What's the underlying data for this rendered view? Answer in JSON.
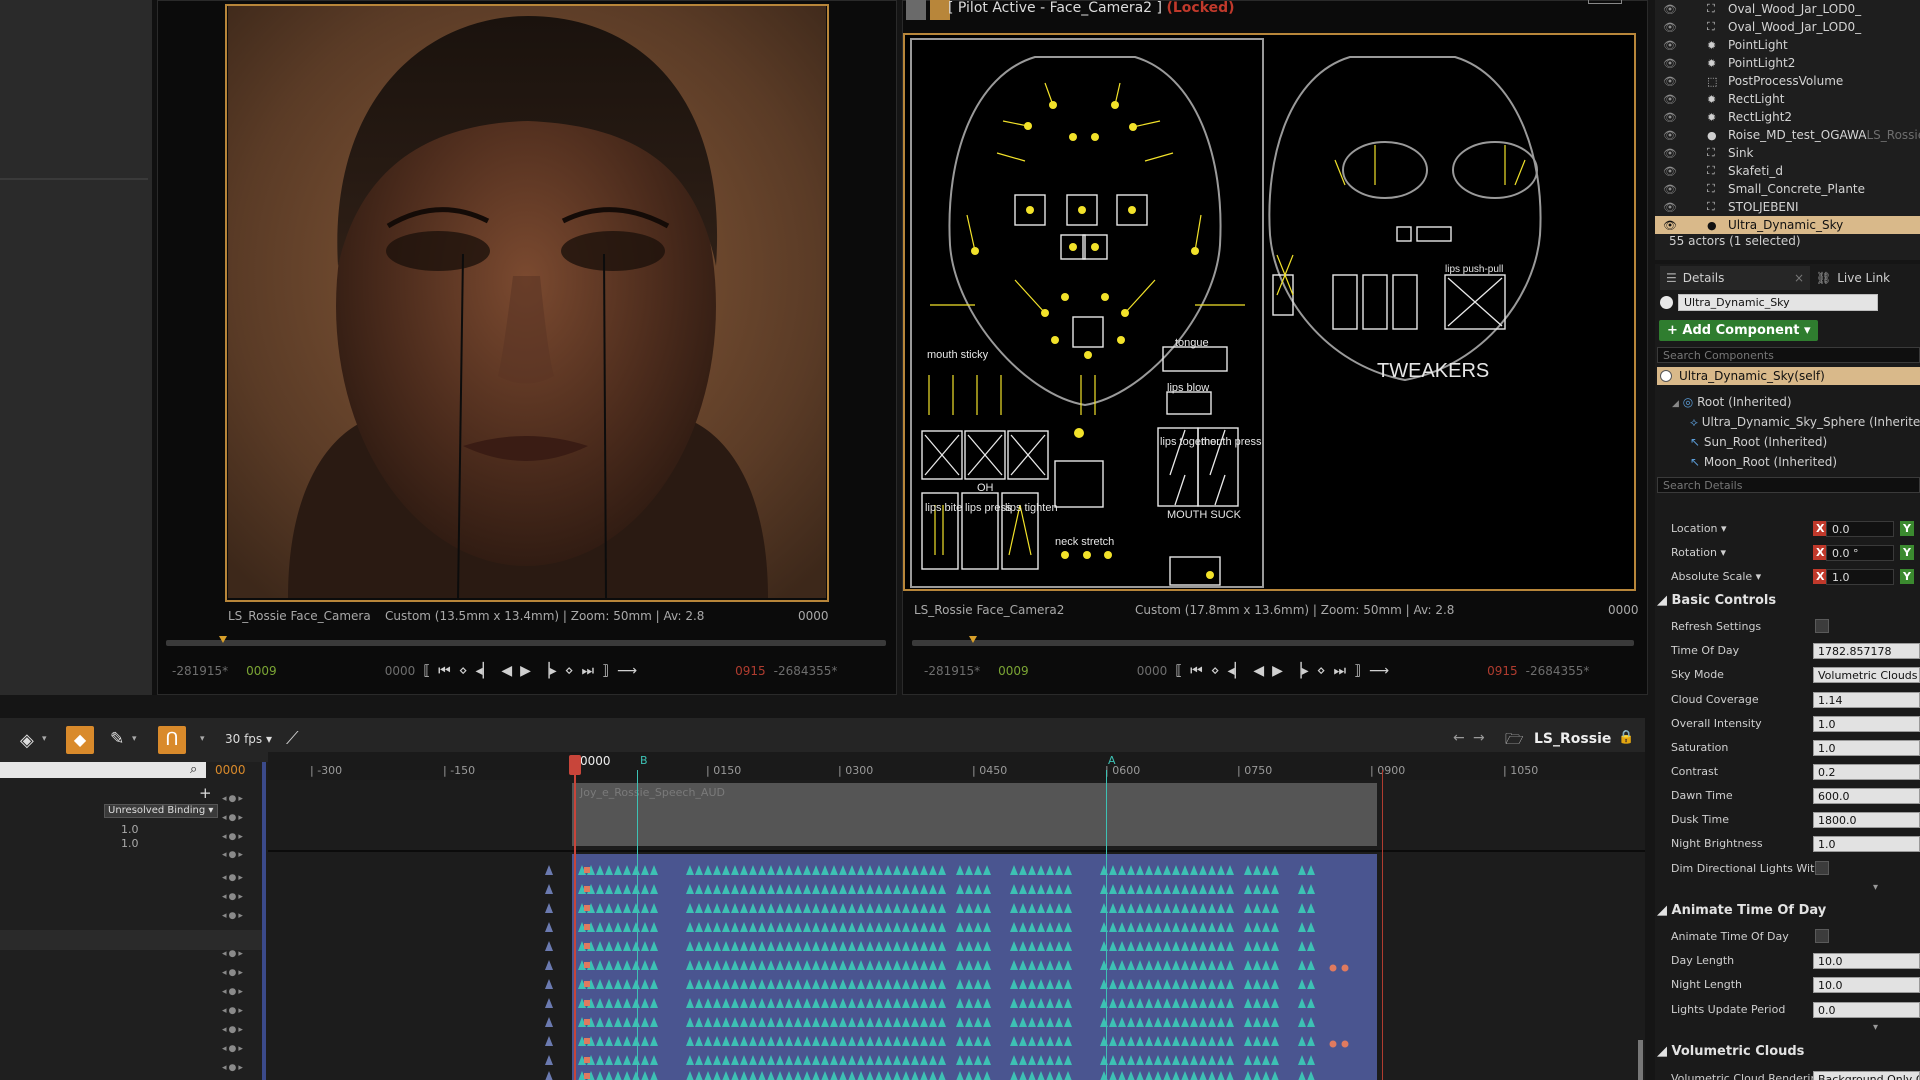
{
  "viewport_left": {
    "camera_name": "LS_Rossie Face_Camera",
    "lens_info": "Custom (13.5mm x 13.4mm) | Zoom: 50mm | Av: 2.8",
    "frame": "0000",
    "transport": {
      "start_far": "-281915*",
      "start": "0009",
      "current": "0000",
      "end": "0915",
      "end_far": "-2684355*"
    }
  },
  "viewport_right": {
    "title": "[ Pilot Active - Face_Camera2 ]",
    "locked": "(Locked)",
    "camera_name": "LS_Rossie Face_Camera2",
    "lens_info": "Custom (17.8mm x 13.6mm) | Zoom: 50mm | Av: 2.8",
    "frame": "0000",
    "transport": {
      "start_far": "-281915*",
      "start": "0009",
      "current": "0000",
      "end": "0915",
      "end_far": "-2684355*"
    },
    "rig_labels": {
      "mouth_sticky": "mouth sticky",
      "tongue": "tongue",
      "lips_blow": "lips blow",
      "lips_together": "lips together",
      "mouth_press": "mouth press",
      "mouth_suck": "MOUTH SUCK",
      "oh": "OH",
      "lips_bite": "lips bite",
      "lips_press": "lips press",
      "lips_tighten": "lips tighten",
      "neck_stretch": "neck stretch",
      "lips_push_pull": "lips push-pull",
      "tweakers": "TWEAKERS"
    }
  },
  "outliner": {
    "items": [
      {
        "name": "Oval_Wood_Jar_LOD0_",
        "icon": "mesh-icon"
      },
      {
        "name": "Oval_Wood_Jar_LOD0_",
        "icon": "mesh-icon"
      },
      {
        "name": "PointLight",
        "icon": "light-icon"
      },
      {
        "name": "PointLight2",
        "icon": "light-icon"
      },
      {
        "name": "PostProcessVolume",
        "icon": "volume-icon"
      },
      {
        "name": "RectLight",
        "icon": "light-icon"
      },
      {
        "name": "RectLight2",
        "icon": "light-icon"
      },
      {
        "name": "Roise_MD_test_OGAWA",
        "suffix": "LS_Rossie",
        "icon": "sphere-icon"
      },
      {
        "name": "Sink",
        "icon": "mesh-icon"
      },
      {
        "name": "Skafeti_d",
        "icon": "mesh-icon"
      },
      {
        "name": "Small_Concrete_Plante",
        "icon": "mesh-icon"
      },
      {
        "name": "STOLJEBENI",
        "icon": "mesh-icon"
      },
      {
        "name": "Ultra_Dynamic_Sky",
        "icon": "sphere-icon",
        "selected": true
      }
    ],
    "actor_count": "55 actors (1 selected)"
  },
  "details": {
    "tab_details": "Details",
    "tab_livelink": "Live Link",
    "actor_name": "Ultra_Dynamic_Sky",
    "add_component": "+ Add Component",
    "search_components": "Search Components",
    "self_row": "Ultra_Dynamic_Sky(self)",
    "components": [
      "Root (Inherited)",
      "Ultra_Dynamic_Sky_Sphere (Inherited)",
      "Sun_Root (Inherited)",
      "Moon_Root (Inherited)"
    ],
    "search_details": "Search Details",
    "transform": [
      {
        "label": "Location",
        "x": "0.0"
      },
      {
        "label": "Rotation",
        "x": "0.0 °"
      },
      {
        "label": "Absolute Scale",
        "x": "1.0"
      }
    ],
    "basic_controls": {
      "title": "Basic Controls",
      "props": [
        {
          "label": "Refresh Settings",
          "type": "check"
        },
        {
          "label": "Time Of Day",
          "value": "1782.857178"
        },
        {
          "label": "Sky Mode",
          "value": "Volumetric Clouds"
        },
        {
          "label": "Cloud Coverage",
          "value": "1.14"
        },
        {
          "label": "Overall Intensity",
          "value": "1.0"
        },
        {
          "label": "Saturation",
          "value": "1.0"
        },
        {
          "label": "Contrast",
          "value": "0.2"
        },
        {
          "label": "Dawn Time",
          "value": "600.0"
        },
        {
          "label": "Dusk Time",
          "value": "1800.0"
        },
        {
          "label": "Night Brightness",
          "value": "1.0"
        },
        {
          "label": "Dim Directional Lights With",
          "type": "check"
        }
      ]
    },
    "animate_tod": {
      "title": "Animate Time Of Day",
      "props": [
        {
          "label": "Animate Time Of Day",
          "type": "check"
        },
        {
          "label": "Day Length",
          "value": "10.0"
        },
        {
          "label": "Night Length",
          "value": "10.0"
        },
        {
          "label": "Lights Update Period",
          "value": "0.0"
        }
      ]
    },
    "volumetric_clouds": {
      "title": "Volumetric Clouds",
      "first_prop": "Volumetric Cloud Rendering",
      "first_value": "Background Only Cl"
    }
  },
  "sequencer": {
    "fps": "30 fps",
    "sequence_name": "LS_Rossie",
    "current_frame": "0000",
    "playhead": "0000",
    "ruler_ticks": [
      "-300",
      "-150",
      "0150",
      "0300",
      "0450",
      "0600",
      "0750",
      "0900",
      "1050"
    ],
    "marker_b": "B",
    "marker_a": "A",
    "unresolved_binding": "Unresolved Binding",
    "val1": "1.0",
    "val2": "1.0",
    "audio_section": "Joy_e_Rossie_Speech_AUD"
  },
  "colors": {
    "accent": "#d9b98a",
    "add_green": "#2f7d2f",
    "locked_red": "#c0392b",
    "key_teal": "#3dc1b4",
    "section_blue": "#4a5590"
  }
}
